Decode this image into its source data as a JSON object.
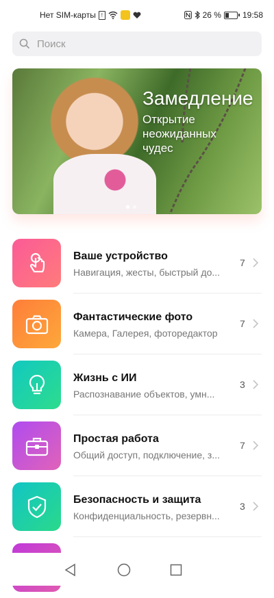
{
  "status_bar": {
    "carrier": "Нет SIM-карты",
    "battery": "26 %",
    "time": "19:58"
  },
  "search": {
    "placeholder": "Поиск"
  },
  "banner": {
    "title": "Замедление",
    "subtitle": "Открытие неожиданных чудес",
    "page_count": 2,
    "active_page": 1
  },
  "list": {
    "items": [
      {
        "icon": "tap-icon",
        "title": "Ваше устройство",
        "desc": "Навигация, жесты, быстрый до...",
        "count": "7",
        "color_from": "#fb5b97",
        "color_to": "#ff7b7b"
      },
      {
        "icon": "camera-icon",
        "title": "Фантастические фото",
        "desc": "Камера, Галерея, фоторедактор",
        "count": "7",
        "color_from": "#ff7e3a",
        "color_to": "#fda83a"
      },
      {
        "icon": "lightbulb-icon",
        "title": "Жизнь с ИИ",
        "desc": "Распознавание объектов, умн...",
        "count": "3",
        "color_from": "#12c9c0",
        "color_to": "#2ddc8d"
      },
      {
        "icon": "briefcase-icon",
        "title": "Простая работа",
        "desc": "Общий доступ, подключение, з...",
        "count": "7",
        "color_from": "#b04cf0",
        "color_to": "#e062b8"
      },
      {
        "icon": "shield-check-icon",
        "title": "Безопасность и защита",
        "desc": "Конфиденциальность, резервн...",
        "count": "3",
        "color_from": "#12c5c5",
        "color_to": "#2ad98a"
      },
      {
        "icon": "partial-icon",
        "title": "",
        "desc": "",
        "count": "",
        "color_from": "#c03ad8",
        "color_to": "#e05bb0"
      }
    ]
  },
  "nav": {
    "back": "back-icon",
    "home": "home-icon",
    "recents": "recents-icon"
  }
}
